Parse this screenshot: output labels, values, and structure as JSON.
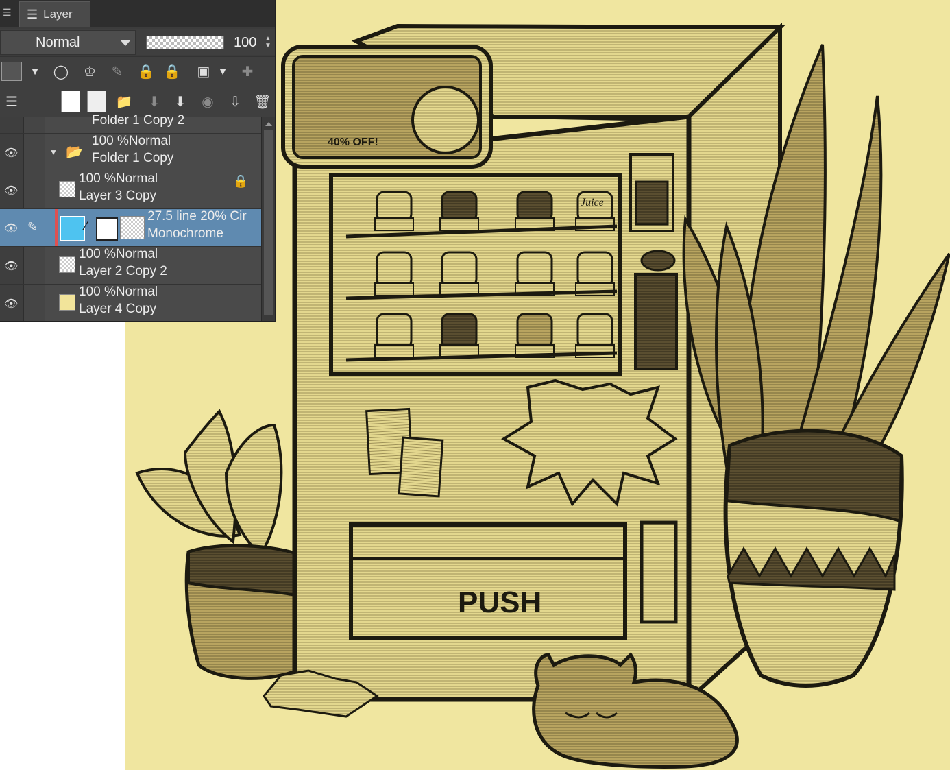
{
  "panel": {
    "tab_title": "Layer",
    "blend_mode": "Normal",
    "opacity_value": "100",
    "layers": [
      {
        "line1": "Folder 1 Copy 2",
        "line2": ""
      },
      {
        "line1": "100 %Normal",
        "line2": "Folder 1 Copy"
      },
      {
        "line1": "100 %Normal",
        "line2": "Layer 3 Copy"
      },
      {
        "line1": "27.5 line 20% Cir",
        "line2": "Monochrome"
      },
      {
        "line1": "100 %Normal",
        "line2": "Layer 2 Copy 2"
      },
      {
        "line1": "100 %Normal",
        "line2": "Layer 4 Copy"
      }
    ]
  },
  "artwork": {
    "sign_text": "40% OFF!",
    "button_text": "PUSH",
    "can_label": "Juice",
    "colors": {
      "background": "#f0e6a0",
      "ink": "#1c1a10",
      "mid": "#b8a460",
      "dark": "#5a4e30",
      "light": "#e8dd9a",
      "panel": "#3c3c3c",
      "selected": "#5f8ab0"
    }
  }
}
